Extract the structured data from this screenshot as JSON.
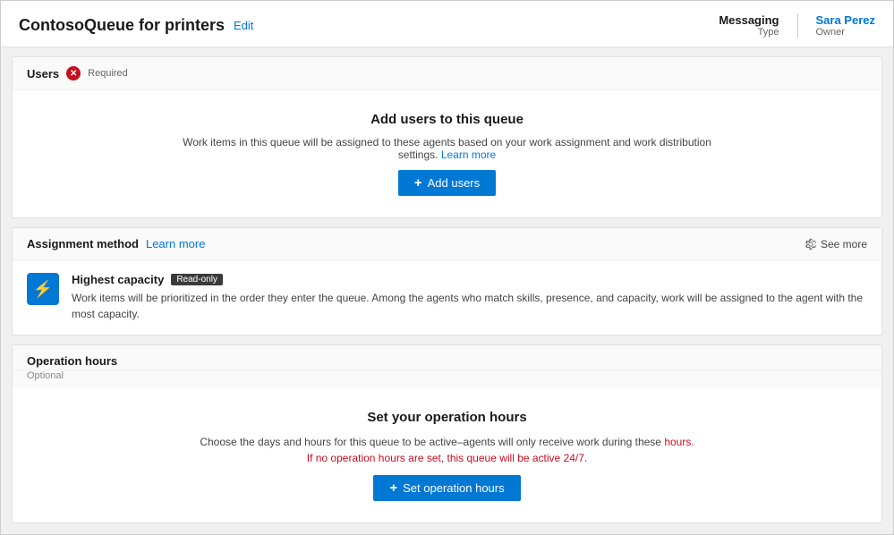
{
  "header": {
    "title": "ContosoQueue for printers",
    "edit_label": "Edit",
    "meta_value": "Messaging",
    "meta_label": "Type",
    "owner_value": "Sara Perez",
    "owner_label": "Owner"
  },
  "users_section": {
    "title": "Users",
    "required_label": "Required",
    "body_title": "Add users to this queue",
    "body_desc_part1": "Work items in this queue will be assigned to these agents based on your work assignment and work distribution settings.",
    "learn_more_label": "Learn more",
    "add_users_label": "Add users"
  },
  "assignment_section": {
    "title": "Assignment method",
    "learn_more_label": "Learn more",
    "see_more_label": "See more",
    "method_name": "Highest capacity",
    "readonly_label": "Read-only",
    "method_desc": "Work items will be prioritized in the order they enter the queue. Among the agents who match skills, presence, and capacity, work will be assigned to the agent with the most capacity."
  },
  "operation_section": {
    "title": "Operation hours",
    "optional_label": "Optional",
    "body_title": "Set your operation hours",
    "body_desc_part1": "Choose the days and hours for this queue to be active–agents will only receive work during these",
    "body_desc_part2": "hours. If no operation hours are set, this queue will be active 24/7.",
    "set_hours_label": "Set operation hours"
  }
}
